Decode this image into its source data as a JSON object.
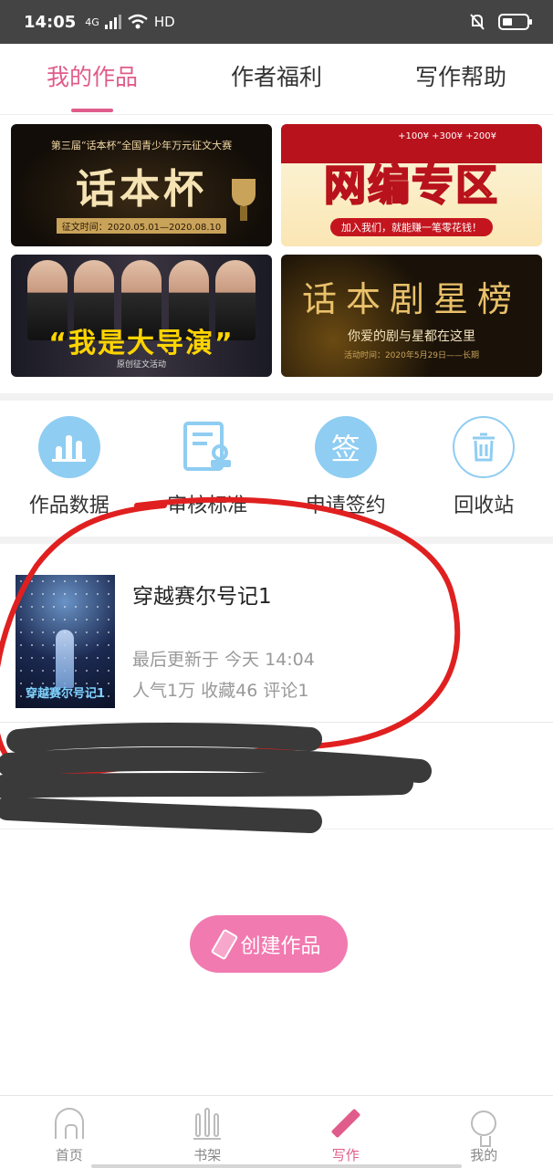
{
  "status_bar": {
    "time": "14:05",
    "network": "4G",
    "hd": "HD",
    "icons": [
      "signal-icon",
      "wifi-icon",
      "mute-icon",
      "battery-icon"
    ]
  },
  "top_tabs": [
    {
      "label": "我的作品",
      "active": true
    },
    {
      "label": "作者福利",
      "active": false
    },
    {
      "label": "写作帮助",
      "active": false
    }
  ],
  "banners": {
    "b1": {
      "top": "第三届“话本杯”全国青少年万元征文大赛",
      "title": "话本杯",
      "date": "征文时间：2020.05.01—2020.08.10"
    },
    "b2": {
      "bonus": "+100¥ +300¥ +200¥",
      "title": "网编专区",
      "ribbon": "加入我们，就能赚一笔零花钱！"
    },
    "b3": {
      "title": "“我是大导演”",
      "sub": "原创征文活动"
    },
    "b4": {
      "title": "话本剧星榜",
      "sub": "你爱的剧与星都在这里",
      "date": "活动时间：2020年5月29日——长期"
    }
  },
  "icon_row": [
    {
      "label": "作品数据",
      "icon": "bar-chart-icon"
    },
    {
      "label": "审核标准",
      "icon": "document-stamp-icon"
    },
    {
      "label": "申请签约",
      "icon": "sign-icon",
      "glyph": "签"
    },
    {
      "label": "回收站",
      "icon": "trash-icon"
    }
  ],
  "work": {
    "title": "穿越赛尔号记1",
    "cover_title": "穿越赛尔号记1",
    "update": "最后更新于 今天 14:04",
    "stats": "人气1万 收藏46 评论1"
  },
  "create_button": {
    "label": "创建作品"
  },
  "bottom_nav": [
    {
      "label": "首页",
      "icon": "home-icon",
      "active": false
    },
    {
      "label": "书架",
      "icon": "bookshelf-icon",
      "active": false
    },
    {
      "label": "写作",
      "icon": "pen-icon",
      "active": true
    },
    {
      "label": "我的",
      "icon": "profile-icon",
      "active": false
    }
  ],
  "colors": {
    "accent": "#e05c8a",
    "icon_blue": "#8fcdf2",
    "create_button": "#f17ab0",
    "annotation_red": "#e02020"
  }
}
